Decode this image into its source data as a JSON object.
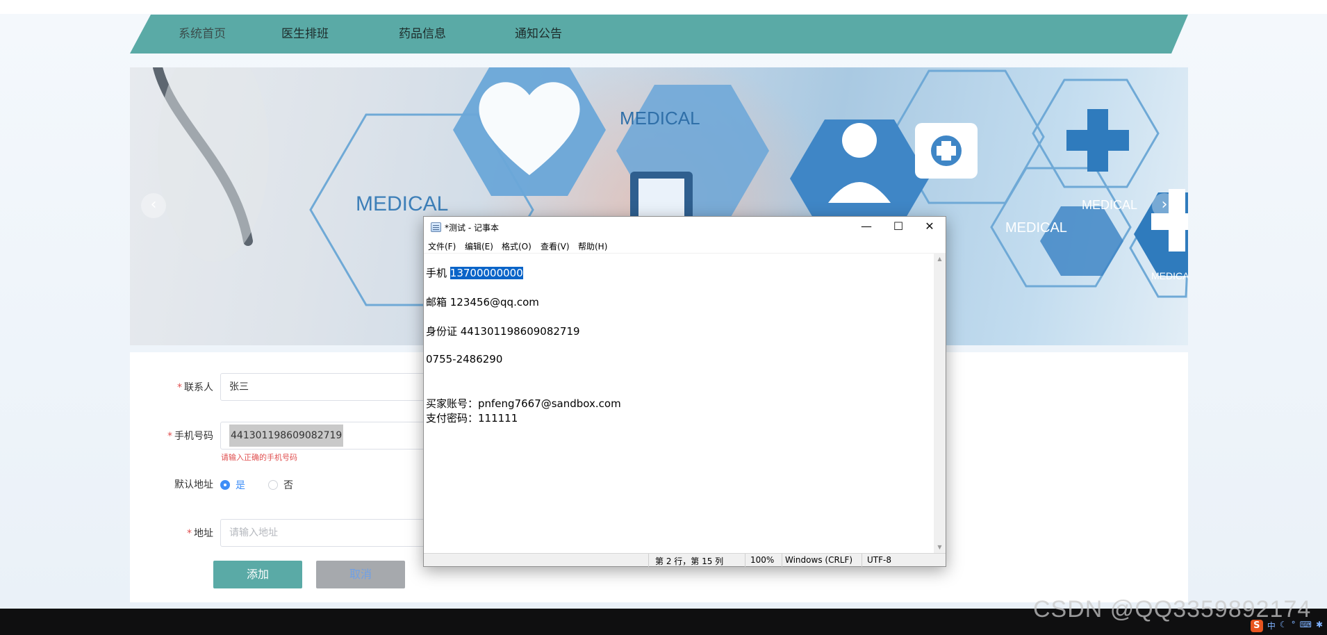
{
  "nav": {
    "items": [
      "系统首页",
      "医生排班",
      "药品信息",
      "通知公告"
    ]
  },
  "banner": {
    "words": [
      "MEDICAL",
      "MEDICAL",
      "MEDICAL",
      "MEDICAL",
      "MEDICAL"
    ],
    "prev": "‹",
    "next": "›"
  },
  "form": {
    "contact_label": "联系人",
    "contact_value": "张三",
    "phone_label": "手机号码",
    "phone_value": "441301198609082719",
    "phone_error": "请输入正确的手机号码",
    "default_label": "默认地址",
    "default_yes": "是",
    "default_no": "否",
    "address_label": "地址",
    "address_placeholder": "请输入地址",
    "submit": "添加",
    "cancel": "取消"
  },
  "notepad": {
    "title": "*测试 - 记事本",
    "menu": [
      "文件(F)",
      "编辑(E)",
      "格式(O)",
      "查看(V)",
      "帮助(H)"
    ],
    "line1_prefix": "手机 ",
    "line1_selected": "13700000000",
    "line2": "邮箱 123456@qq.com",
    "line3": "身份证 441301198609082719",
    "line4": "0755-2486290",
    "line5": "买家账号：pnfeng7667@sandbox.com",
    "line6": "支付密码：111111",
    "status": {
      "position": "第 2 行，第 15 列",
      "zoom": "100%",
      "eol": "Windows (CRLF)",
      "encoding": "UTF-8"
    },
    "minimize": "—",
    "maximize": "☐",
    "close": "✕"
  },
  "taskbar": {
    "watermark": "CSDN @QQ3359892174",
    "ime": "S",
    "ime_mode": "中"
  },
  "colors": {
    "nav": "#5aaaa6",
    "button": "#5aaaa6",
    "accent": "#3e8ef7",
    "error": "#e05050",
    "selection": "#0a64c8"
  }
}
